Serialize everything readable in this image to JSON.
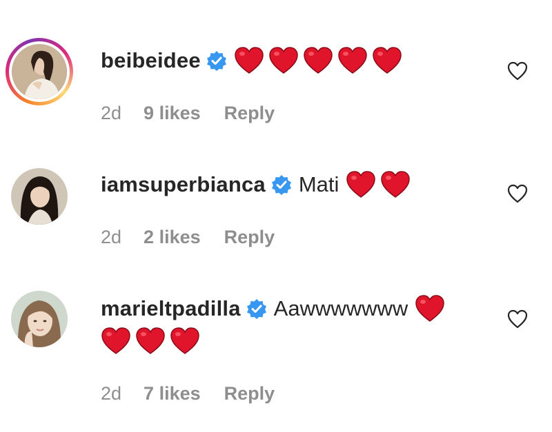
{
  "comments": [
    {
      "username": "beibeidee",
      "text": "",
      "time": "2d",
      "likes": "9 likes",
      "reply": "Reply",
      "heart_count": 5,
      "has_story_ring": true
    },
    {
      "username": "iamsuperbianca",
      "text": "Mati",
      "time": "2d",
      "likes": "2 likes",
      "reply": "Reply",
      "heart_count": 2,
      "has_story_ring": false
    },
    {
      "username": "marieltpadilla",
      "text": "Aawwwwwww",
      "time": "2d",
      "likes": "7 likes",
      "reply": "Reply",
      "heart_count": 4,
      "has_story_ring": false
    }
  ],
  "icons": {
    "verified": "verified-badge-icon",
    "heart_emoji": "red-heart-emoji",
    "like": "heart-outline-icon"
  },
  "colors": {
    "verified_blue": "#3897f0",
    "heart_red": "#e0142b",
    "meta_gray": "#8e8e8e",
    "text": "#262626"
  }
}
